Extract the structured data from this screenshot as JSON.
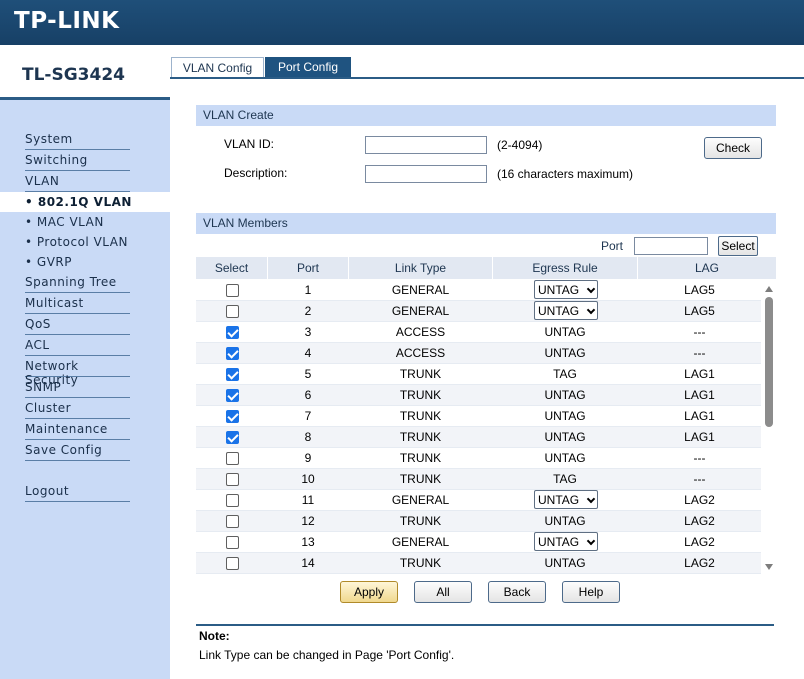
{
  "brand": "TP-LINK",
  "model": "TL-SG3424",
  "tabs": [
    {
      "label": "VLAN Config"
    },
    {
      "label": "Port Config"
    }
  ],
  "sidebar": {
    "items": [
      "System",
      "Switching",
      "VLAN"
    ],
    "sub_items": [
      "• 802.1Q VLAN",
      "• MAC VLAN",
      "• Protocol VLAN",
      "• GVRP"
    ],
    "items2": [
      "Spanning Tree",
      "Multicast",
      "QoS",
      "ACL",
      "Network Security",
      "SNMP",
      "Cluster",
      "Maintenance",
      "Save Config"
    ],
    "logout": "Logout"
  },
  "vlan_create": {
    "header": "VLAN Create",
    "vlan_id_label": "VLAN ID:",
    "vlan_id_value": "",
    "vlan_id_hint": "(2-4094)",
    "desc_label": "Description:",
    "desc_value": "",
    "desc_hint": "(16 characters maximum)",
    "check_label": "Check"
  },
  "vlan_members": {
    "header": "VLAN Members",
    "port_label": "Port",
    "port_value": "",
    "select_button": "Select",
    "columns": [
      "Select",
      "Port",
      "Link Type",
      "Egress Rule",
      "LAG"
    ],
    "rows": [
      {
        "checked": false,
        "port": "1",
        "link": "GENERAL",
        "egress": "UNTAG",
        "dropdown": true,
        "lag": "LAG5"
      },
      {
        "checked": false,
        "port": "2",
        "link": "GENERAL",
        "egress": "UNTAG",
        "dropdown": true,
        "lag": "LAG5"
      },
      {
        "checked": true,
        "port": "3",
        "link": "ACCESS",
        "egress": "UNTAG",
        "dropdown": false,
        "lag": "---"
      },
      {
        "checked": true,
        "port": "4",
        "link": "ACCESS",
        "egress": "UNTAG",
        "dropdown": false,
        "lag": "---"
      },
      {
        "checked": true,
        "port": "5",
        "link": "TRUNK",
        "egress": "TAG",
        "dropdown": false,
        "lag": "LAG1"
      },
      {
        "checked": true,
        "port": "6",
        "link": "TRUNK",
        "egress": "UNTAG",
        "dropdown": false,
        "lag": "LAG1"
      },
      {
        "checked": true,
        "port": "7",
        "link": "TRUNK",
        "egress": "UNTAG",
        "dropdown": false,
        "lag": "LAG1"
      },
      {
        "checked": true,
        "port": "8",
        "link": "TRUNK",
        "egress": "UNTAG",
        "dropdown": false,
        "lag": "LAG1"
      },
      {
        "checked": false,
        "port": "9",
        "link": "TRUNK",
        "egress": "UNTAG",
        "dropdown": false,
        "lag": "---"
      },
      {
        "checked": false,
        "port": "10",
        "link": "TRUNK",
        "egress": "TAG",
        "dropdown": false,
        "lag": "---"
      },
      {
        "checked": false,
        "port": "11",
        "link": "GENERAL",
        "egress": "UNTAG",
        "dropdown": true,
        "lag": "LAG2"
      },
      {
        "checked": false,
        "port": "12",
        "link": "TRUNK",
        "egress": "UNTAG",
        "dropdown": false,
        "lag": "LAG2"
      },
      {
        "checked": false,
        "port": "13",
        "link": "GENERAL",
        "egress": "UNTAG",
        "dropdown": true,
        "lag": "LAG2"
      },
      {
        "checked": false,
        "port": "14",
        "link": "TRUNK",
        "egress": "UNTAG",
        "dropdown": false,
        "lag": "LAG2"
      }
    ]
  },
  "buttons": {
    "apply": "Apply",
    "all": "All",
    "back": "Back",
    "help": "Help"
  },
  "note": {
    "title": "Note:",
    "text": "Link Type can be changed in Page 'Port Config'."
  }
}
